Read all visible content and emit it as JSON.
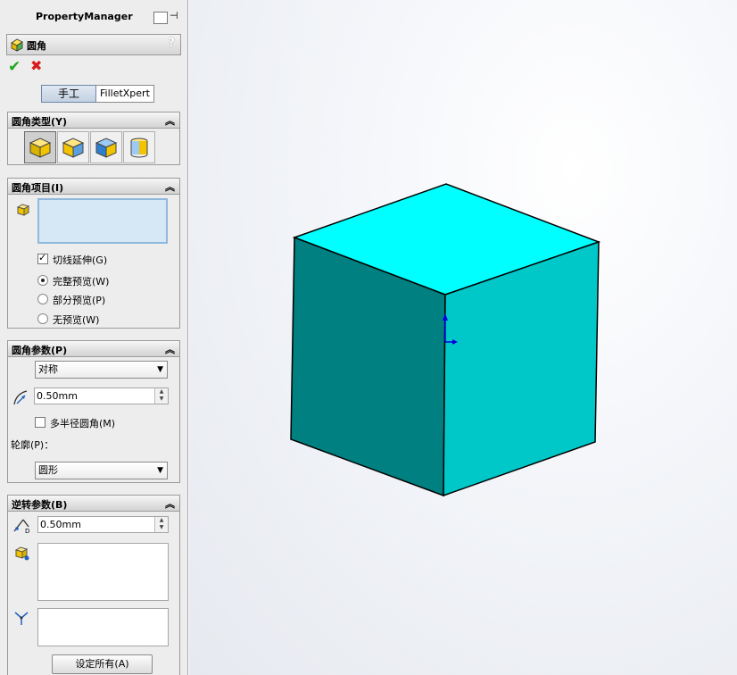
{
  "panel": {
    "title": "PropertyManager",
    "feature_name": "圆角",
    "help": "?",
    "ok": "✔",
    "cancel": "✖",
    "tabs": {
      "manual": "手工",
      "expert": "FilletXpert"
    }
  },
  "fillet_type": {
    "title": "圆角类型(Y)",
    "collapse": "︽"
  },
  "fillet_items": {
    "title": "圆角项目(I)",
    "collapse": "︽",
    "tangent_propagation": "切线延伸(G)",
    "full_preview": "完整预览(W)",
    "partial_preview": "部分预览(P)",
    "no_preview": "无预览(W)"
  },
  "fillet_params": {
    "title": "圆角参数(P)",
    "collapse": "︽",
    "method": "对称",
    "radius": "0.50mm",
    "multi_radius": "多半径圆角(M)",
    "profile_label": "轮廓(P)：",
    "profile": "圆形"
  },
  "setback_params": {
    "title": "逆转参数(B)",
    "collapse": "︽",
    "distance": "0.50mm",
    "set_all": "设定所有(A)"
  },
  "colors": {
    "cube_top": "#00ffff",
    "cube_left": "#008080",
    "cube_right": "#00c8c8"
  }
}
